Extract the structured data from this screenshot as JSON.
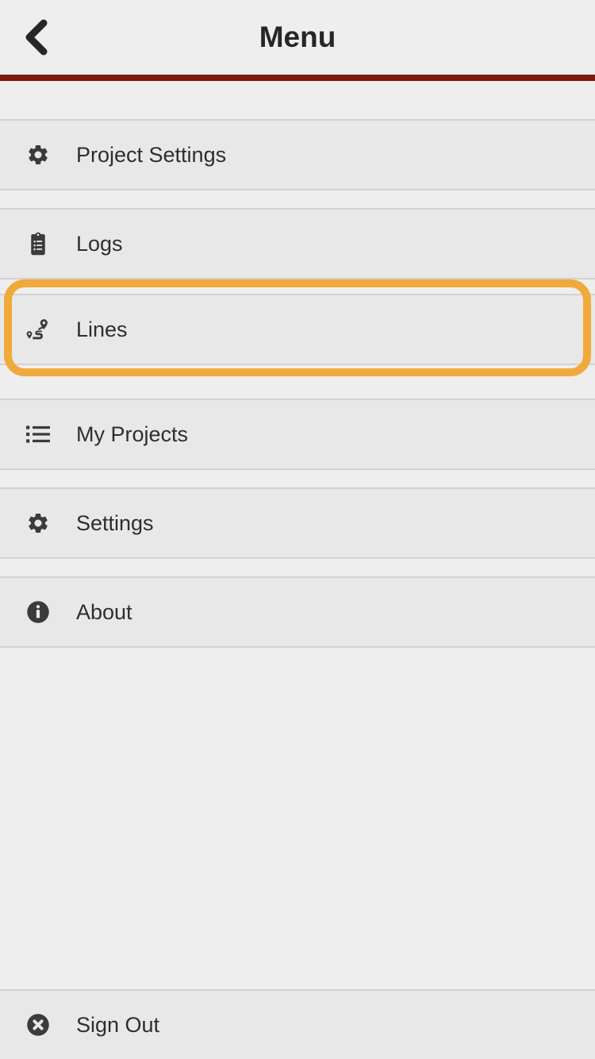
{
  "header": {
    "title": "Menu",
    "back_icon": "chevron-left-icon",
    "accent_color": "#7d1a0f"
  },
  "highlight": {
    "color": "#f0a93b",
    "target": "Lines"
  },
  "menu": {
    "groups": [
      {
        "items": [
          {
            "label": "Project Settings",
            "icon": "gear-icon",
            "name": "project-settings",
            "highlighted": false
          }
        ]
      },
      {
        "items": [
          {
            "label": "Logs",
            "icon": "clipboard-list-icon",
            "name": "logs",
            "highlighted": false
          }
        ]
      },
      {
        "items": [
          {
            "label": "Lines",
            "icon": "route-icon",
            "name": "lines",
            "highlighted": true
          }
        ]
      },
      {
        "items": [
          {
            "label": "My Projects",
            "icon": "list-bullet-icon",
            "name": "my-projects",
            "highlighted": false
          }
        ]
      },
      {
        "items": [
          {
            "label": "Settings",
            "icon": "gear-icon",
            "name": "settings",
            "highlighted": false
          }
        ]
      },
      {
        "items": [
          {
            "label": "About",
            "icon": "info-circle-icon",
            "name": "about",
            "highlighted": false
          }
        ]
      }
    ]
  },
  "footer": {
    "sign_out": {
      "label": "Sign Out",
      "icon": "close-circle-icon",
      "name": "sign-out"
    }
  }
}
